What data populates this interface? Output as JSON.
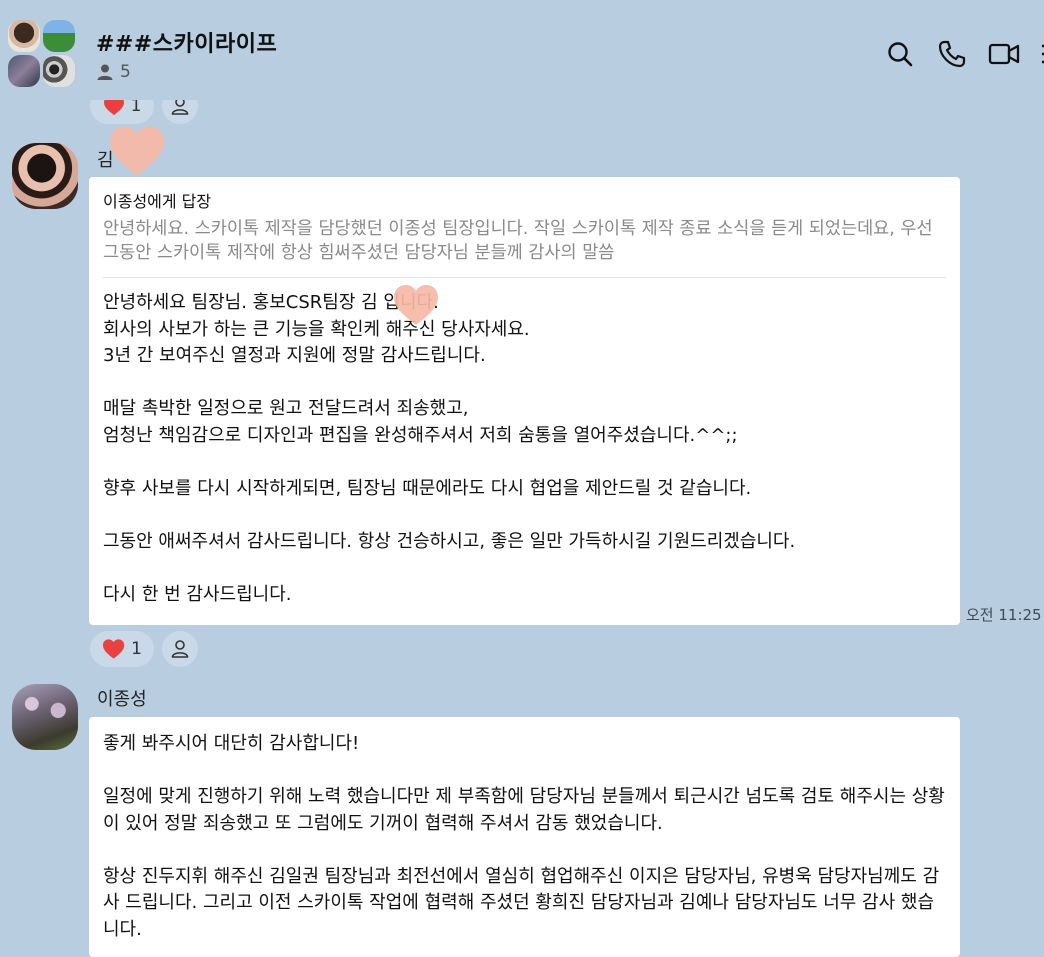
{
  "header": {
    "room_title": "###스카이라이프",
    "member_count": "5",
    "icons": [
      "search-icon",
      "phone-icon",
      "video-icon",
      "menu-icon"
    ]
  },
  "top_reaction": {
    "heart_count": "1"
  },
  "messages": [
    {
      "sender": "김",
      "reply_to_label": "이종성에게 답장",
      "reply_preview": "안녕하세요. 스카이톡 제작을 담당했던 이종성 팀장입니다. 작일 스카이톡 제작 종료 소식을 듣게 되었는데요, 우선 그동안 스카이톡 제작에 항상 힘써주셨던 담당자님 분들께 감사의 말씀",
      "text": "안녕하세요 팀장님. 홍보CSR팀장 김 입니다.\n회사의 사보가 하는 큰 기능을 확인케 해주신 당사자세요.\n3년 간 보여주신 열정과 지원에 정말 감사드립니다.\n\n매달 촉박한 일정으로 원고 전달드려서 죄송했고,\n엄청난 책임감으로 디자인과 편집을 완성해주셔서 저희 숨통을 열어주셨습니다.^^;;\n\n향후 사보를 다시 시작하게되면, 팀장님 때문에라도 다시 협업을 제안드릴 것 같습니다.\n\n그동안 애써주셔서 감사드립니다. 항상 건승하시고, 좋은 일만 가득하시길 기원드리겠습니다.\n\n다시 한 번 감사드립니다.",
      "time": "오전 11:25",
      "heart_count": "1"
    },
    {
      "sender": "이종성",
      "text": "좋게 봐주시어 대단히 감사합니다!\n\n일정에 맞게 진행하기 위해 노력 했습니다만 제 부족함에 담당자님 분들께서 퇴근시간 넘도록 검토 해주시는 상황이 있어 정말 죄송했고 또 그럼에도 기꺼이 협력해 주셔서 감동 했었습니다.\n\n항상 진두지휘 해주신 김일권 팀장님과 최전선에서 열심히 협업해주신 이지은 담당자님, 유병욱 담당자님께도 감사 드립니다. 그리고 이전 스카이톡 작업에 협력해 주셨던 황희진 담당자님과 김예나 담당자님도 너무 감사 했습니다."
    }
  ],
  "colors": {
    "background": "#b9cde0",
    "bubble": "#ffffff",
    "heart": "#e8413f",
    "heart_overlay": "#f6b8a6"
  }
}
